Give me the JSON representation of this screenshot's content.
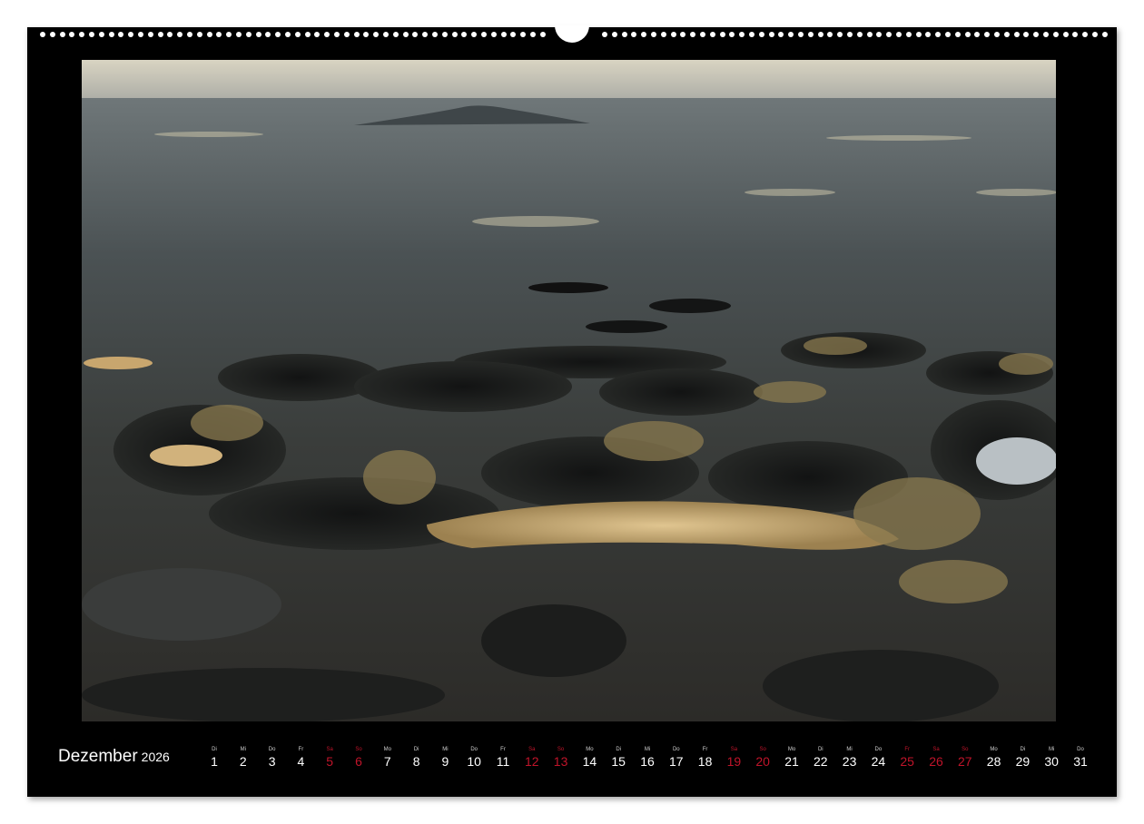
{
  "calendar": {
    "month": "Dezember",
    "year": "2026",
    "accent_color": "#c0142a",
    "days": [
      {
        "wd": "Di",
        "num": "1",
        "weekend": false
      },
      {
        "wd": "Mi",
        "num": "2",
        "weekend": false
      },
      {
        "wd": "Do",
        "num": "3",
        "weekend": false
      },
      {
        "wd": "Fr",
        "num": "4",
        "weekend": false
      },
      {
        "wd": "Sa",
        "num": "5",
        "weekend": true
      },
      {
        "wd": "So",
        "num": "6",
        "weekend": true
      },
      {
        "wd": "Mo",
        "num": "7",
        "weekend": false
      },
      {
        "wd": "Di",
        "num": "8",
        "weekend": false
      },
      {
        "wd": "Mi",
        "num": "9",
        "weekend": false
      },
      {
        "wd": "Do",
        "num": "10",
        "weekend": false
      },
      {
        "wd": "Fr",
        "num": "11",
        "weekend": false
      },
      {
        "wd": "Sa",
        "num": "12",
        "weekend": true
      },
      {
        "wd": "So",
        "num": "13",
        "weekend": true
      },
      {
        "wd": "Mo",
        "num": "14",
        "weekend": false
      },
      {
        "wd": "Di",
        "num": "15",
        "weekend": false
      },
      {
        "wd": "Mi",
        "num": "16",
        "weekend": false
      },
      {
        "wd": "Do",
        "num": "17",
        "weekend": false
      },
      {
        "wd": "Fr",
        "num": "18",
        "weekend": false
      },
      {
        "wd": "Sa",
        "num": "19",
        "weekend": true
      },
      {
        "wd": "So",
        "num": "20",
        "weekend": true
      },
      {
        "wd": "Mo",
        "num": "21",
        "weekend": false
      },
      {
        "wd": "Di",
        "num": "22",
        "weekend": false
      },
      {
        "wd": "Mi",
        "num": "23",
        "weekend": false
      },
      {
        "wd": "Do",
        "num": "24",
        "weekend": false
      },
      {
        "wd": "Fr",
        "num": "25",
        "weekend": true
      },
      {
        "wd": "Sa",
        "num": "26",
        "weekend": true
      },
      {
        "wd": "So",
        "num": "27",
        "weekend": true
      },
      {
        "wd": "Mo",
        "num": "28",
        "weekend": false
      },
      {
        "wd": "Di",
        "num": "29",
        "weekend": false
      },
      {
        "wd": "Mi",
        "num": "30",
        "weekend": false
      },
      {
        "wd": "Do",
        "num": "31",
        "weekend": false
      }
    ]
  }
}
